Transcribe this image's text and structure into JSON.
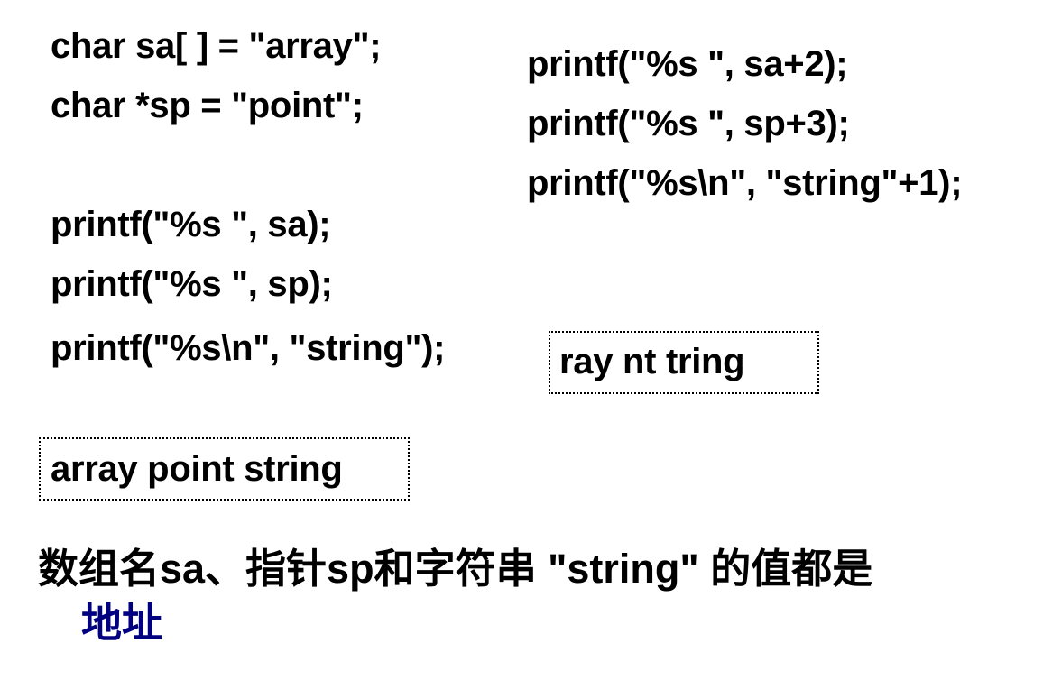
{
  "code_left": [
    "char sa[ ] = \"array\";",
    "char *sp = \"point\";",
    "printf(\"%s \", sa);",
    "printf(\"%s \", sp);",
    "printf(\"%s\\n\", \"string\");"
  ],
  "code_right": [
    "printf(\"%s \", sa+2);",
    "printf(\"%s \", sp+3);",
    "printf(\"%s\\n\", \"string\"+1);"
  ],
  "output_right": "ray nt tring",
  "output_left": "array point string",
  "conclusion": {
    "text": "数组名sa、指针sp和字符串 \"string\" 的值都是",
    "highlight": "地址",
    "highlight_color": "#000080"
  }
}
